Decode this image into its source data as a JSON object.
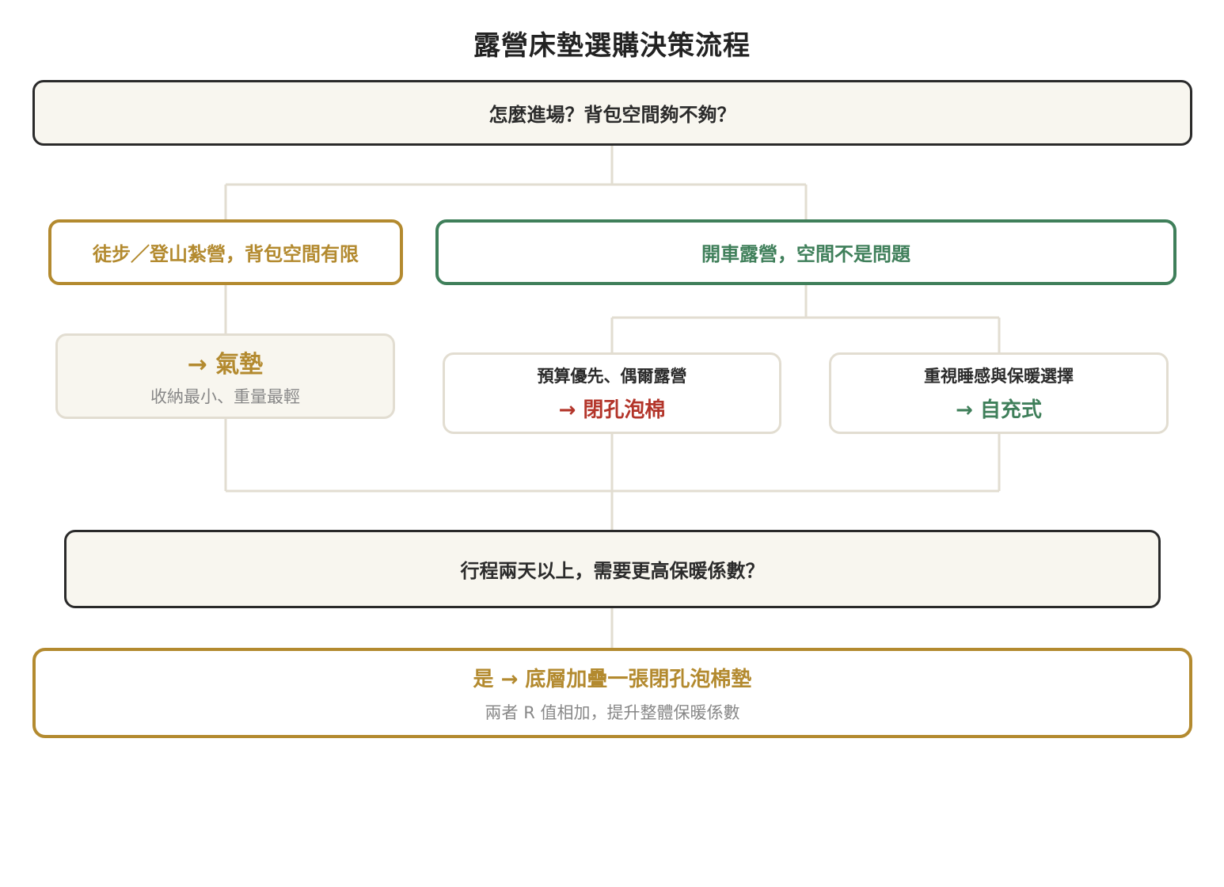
{
  "title": "露營床墊選購決策流程",
  "question1": "怎麼進場？背包空間夠不夠？",
  "branches": {
    "hiking": "徒步／登山紮營，背包空間有限",
    "car": "開車露營，空間不是問題"
  },
  "results": {
    "air": {
      "label": "→ 氣墊",
      "note": "收納最小、重量最輕"
    },
    "foam": {
      "condition": "預算優先、偶爾露營",
      "label": "→ 閉孔泡棉"
    },
    "self_inflating": {
      "condition": "重視睡感與保暖選擇",
      "label": "→ 自充式"
    }
  },
  "question2": "行程兩天以上，需要更高保暖係數？",
  "final": {
    "label": "是 → 底層加疊一張閉孔泡棉墊",
    "note": "兩者 R 值相加，提升整體保暖係數"
  },
  "colors": {
    "gold": "#b38a2f",
    "green": "#3f7f5a",
    "red": "#b3352a",
    "connector": "#e2ddd1",
    "box_fill": "#f8f6ef"
  }
}
